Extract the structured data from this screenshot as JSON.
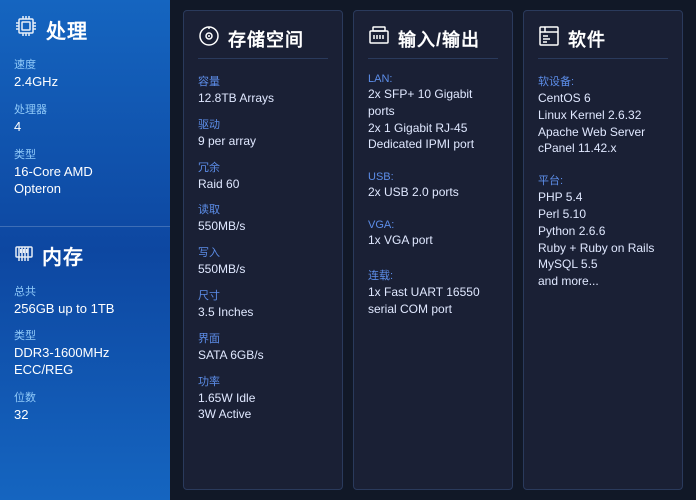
{
  "leftPanel": {
    "cpu": {
      "title": "处理",
      "specs": [
        {
          "label": "速度",
          "value": "2.4GHz"
        },
        {
          "label": "处理器",
          "value": "4"
        },
        {
          "label": "类型",
          "value": "16-Core AMD\nOpteron"
        }
      ]
    },
    "memory": {
      "title": "内存",
      "specs": [
        {
          "label": "总共",
          "value": "256GB up to 1TB"
        },
        {
          "label": "类型",
          "value": "DDR3-1600MHz\nECC/REG"
        },
        {
          "label": "位数",
          "value": "32"
        }
      ]
    }
  },
  "panels": [
    {
      "id": "storage",
      "title": "存储空间",
      "specs": [
        {
          "label": "容量",
          "value": "12.8TB Arrays"
        },
        {
          "label": "驱动",
          "value": "9 per array"
        },
        {
          "label": "冗余",
          "value": "Raid 60"
        },
        {
          "label": "读取",
          "value": "550MB/s"
        },
        {
          "label": "写入",
          "value": "550MB/s"
        },
        {
          "label": "尺寸",
          "value": "3.5 Inches"
        },
        {
          "label": "界面",
          "value": "SATA 6GB/s"
        },
        {
          "label": "功率",
          "value": "1.65W Idle\n3W Active"
        }
      ]
    },
    {
      "id": "io",
      "title": "输入/输出",
      "categories": [
        {
          "label": "LAN:",
          "value": "2x SFP+ 10 Gigabit\nports\n2x 1 Gigabit RJ-45\nDedicated IPMI port"
        },
        {
          "label": "USB:",
          "value": "2x USB 2.0 ports"
        },
        {
          "label": "VGA:",
          "value": "1x VGA port"
        },
        {
          "label": "连载:",
          "value": "1x Fast UART 16550\nserial COM port"
        }
      ]
    },
    {
      "id": "software",
      "title": "软件",
      "groups": [
        {
          "label": "软设备:",
          "items": [
            "CentOS 6",
            "Linux Kernel 2.6.32",
            "Apache Web Server",
            "cPanel 11.42.x"
          ]
        },
        {
          "label": "平台:",
          "items": [
            "PHP 5.4",
            "Perl 5.10",
            "Python 2.6.6",
            "Ruby + Ruby on Rails",
            "MySQL 5.5",
            "and more..."
          ]
        }
      ]
    }
  ]
}
